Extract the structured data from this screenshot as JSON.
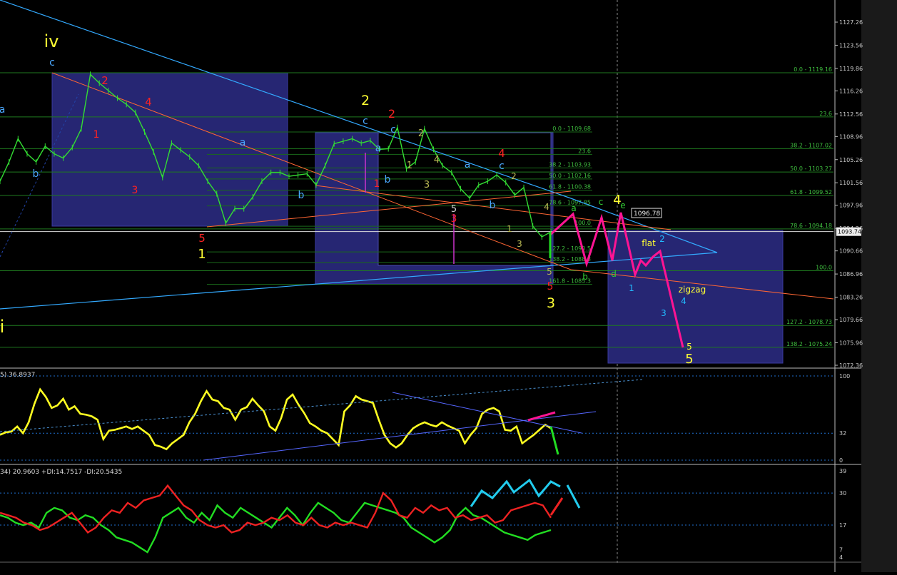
{
  "chart_data": [
    {
      "type": "line",
      "ylim": [
        1072.36,
        1130.96
      ],
      "y_ticks": [
        "1127.26",
        "1123.56",
        "1119.86",
        "1116.26",
        "1112.56",
        "1108.96",
        "1105.26",
        "1101.56",
        "1097.96",
        "1094.26",
        "1090.66",
        "1086.96",
        "1083.26",
        "1079.66",
        "1075.96",
        "1072.36"
      ],
      "price_label": "1093.74",
      "marker_label": "1096.78",
      "price_values": [
        1101.8,
        1104.9,
        1108.6,
        1106.2,
        1104.9,
        1107.4,
        1106.2,
        1105.5,
        1107.2,
        1110.2,
        1118.9,
        1117.5,
        1116.3,
        1115.1,
        1114.1,
        1112.8,
        1109.7,
        1106.5,
        1102.4,
        1107.9,
        1106.8,
        1105.7,
        1104.3,
        1101.8,
        1099.8,
        1095.1,
        1097.4,
        1097.4,
        1099.3,
        1101.8,
        1103.2,
        1103.2,
        1102.6,
        1102.8,
        1103.0,
        1101.2,
        1104.3,
        1107.8,
        1108.2,
        1108.6,
        1107.9,
        1108.3,
        1106.9,
        1107.0,
        1110.4,
        1103.8,
        1104.9,
        1110.2,
        1106.9,
        1104.3,
        1103.2,
        1100.6,
        1099.1,
        1101.2,
        1101.8,
        1102.8,
        1101.6,
        1099.6,
        1100.8,
        1094.6,
        1092.9,
        1093.7
      ],
      "green_labels": [
        {
          "text": "0.0 - 1119.16",
          "price": 1119.16
        },
        {
          "text": "23.6",
          "price": 1112.1
        },
        {
          "text": "38.2 - 1107.02",
          "price": 1107.02
        },
        {
          "text": "50.0 - 1103.27",
          "price": 1103.27
        },
        {
          "text": "61.8 - 1099.52",
          "price": 1099.52
        },
        {
          "text": "78.6 - 1094.18",
          "price": 1094.18
        },
        {
          "text": "100.0",
          "price": 1087.48
        },
        {
          "text": "127.2 - 1078.73",
          "price": 1078.73
        },
        {
          "text": "138.2 - 1075.24",
          "price": 1075.24
        }
      ],
      "inner_fib_labels": [
        {
          "text": "0.0 - 1109.68",
          "price": 1109.68
        },
        {
          "text": "23.6",
          "price": 1106.1
        },
        {
          "text": "38.2 - 1103.93",
          "price": 1103.93
        },
        {
          "text": "50.0 - 1102.16",
          "price": 1102.16
        },
        {
          "text": "61.8 - 1100.38",
          "price": 1100.38
        },
        {
          "text": "78.6 - 1097.85",
          "price": 1097.85
        },
        {
          "text": "100.0",
          "price": 1094.6
        },
        {
          "text": "127.2 - 1090.5",
          "price": 1090.5
        },
        {
          "text": "138.2 - 1088.8",
          "price": 1088.8
        },
        {
          "text": "161.8 - 1085.3",
          "price": 1085.3
        }
      ],
      "wave_labels": [
        {
          "text": "iv",
          "color": "#ffff33",
          "size": 24
        },
        {
          "text": "c",
          "color": "#4aa8ff",
          "size": 14
        },
        {
          "text": "a",
          "color": "#4aa8ff",
          "size": 14
        },
        {
          "text": "b",
          "color": "#4aa8ff",
          "size": 14
        },
        {
          "text": "2",
          "color": "#ff2222",
          "size": 15
        },
        {
          "text": "4",
          "color": "#ff2222",
          "size": 15
        },
        {
          "text": "1",
          "color": "#ff2222",
          "size": 14
        },
        {
          "text": "3",
          "color": "#ff2222",
          "size": 14
        },
        {
          "text": "5",
          "color": "#ff2222",
          "size": 15
        },
        {
          "text": "1",
          "color": "#ffff33",
          "size": 18
        },
        {
          "text": "a",
          "color": "#4aa8ff",
          "size": 14
        },
        {
          "text": "b",
          "color": "#4aa8ff",
          "size": 14
        },
        {
          "text": "2",
          "color": "#ffff33",
          "size": 19
        },
        {
          "text": "c",
          "color": "#4aa8ff",
          "size": 14
        },
        {
          "text": "1",
          "color": "#ff2222",
          "size": 14
        },
        {
          "text": "2",
          "color": "#ff2222",
          "size": 16
        },
        {
          "text": "c",
          "color": "#4aa8ff",
          "size": 14
        },
        {
          "text": "a",
          "color": "#4aa8ff",
          "size": 14
        },
        {
          "text": "b",
          "color": "#4aa8ff",
          "size": 14
        },
        {
          "text": "2",
          "color": "#bbbb55",
          "size": 13
        },
        {
          "text": "1",
          "color": "#bbbb55",
          "size": 13
        },
        {
          "text": "4",
          "color": "#bbbb55",
          "size": 13
        },
        {
          "text": "3",
          "color": "#bbbb55",
          "size": 13
        },
        {
          "text": "5",
          "color": "#cccccc",
          "size": 13
        },
        {
          "text": "3",
          "color": "#ff2222",
          "size": 14
        },
        {
          "text": "a",
          "color": "#4aa8ff",
          "size": 14
        },
        {
          "text": "c",
          "color": "#4aa8ff",
          "size": 14
        },
        {
          "text": "4",
          "color": "#ff2222",
          "size": 15
        },
        {
          "text": "b",
          "color": "#4aa8ff",
          "size": 14
        },
        {
          "text": "2",
          "color": "#bbbb55",
          "size": 12
        },
        {
          "text": "1",
          "color": "#bbbb55",
          "size": 12
        },
        {
          "text": "3",
          "color": "#bbbb55",
          "size": 12
        },
        {
          "text": "4",
          "color": "#bbbb55",
          "size": 12
        },
        {
          "text": "5",
          "color": "#bbbb55",
          "size": 12
        },
        {
          "text": "5",
          "color": "#ff2222",
          "size": 14
        },
        {
          "text": "3",
          "color": "#ffff33",
          "size": 19
        },
        {
          "text": "a",
          "color": "#33cc33",
          "size": 12
        },
        {
          "text": "b",
          "color": "#33cc33",
          "size": 12
        },
        {
          "text": "c",
          "color": "#33cc33",
          "size": 12
        },
        {
          "text": "d",
          "color": "#33cc33",
          "size": 12
        },
        {
          "text": "4",
          "color": "#ffff33",
          "size": 18
        },
        {
          "text": "e",
          "color": "#33cc33",
          "size": 12
        },
        {
          "text": "flat",
          "color": "#ffff33",
          "size": 12
        },
        {
          "text": "2",
          "color": "#22bbff",
          "size": 12
        },
        {
          "text": "1",
          "color": "#22bbff",
          "size": 12
        },
        {
          "text": "3",
          "color": "#22bbff",
          "size": 12
        },
        {
          "text": "zigzag",
          "color": "#ffff33",
          "size": 12
        },
        {
          "text": "4",
          "color": "#22bbff",
          "size": 12
        },
        {
          "text": "5",
          "color": "#ffff33",
          "size": 12
        },
        {
          "text": "5",
          "color": "#ffff33",
          "size": 18
        },
        {
          "text": "i",
          "color": "#ffff33",
          "size": 24
        }
      ]
    },
    {
      "type": "line",
      "title": "5) 36.8937",
      "ylim": [
        0,
        100
      ],
      "y_ticks": [
        "100",
        "32",
        "0"
      ],
      "series": [
        {
          "color": "#ffff22",
          "values": [
            30,
            33,
            34,
            40,
            32,
            45,
            67,
            84,
            75,
            62,
            65,
            73,
            60,
            64,
            55,
            54,
            52,
            48,
            25,
            35,
            36,
            38,
            40,
            37,
            40,
            35,
            30,
            18,
            16,
            13,
            20,
            25,
            30,
            45,
            55,
            70,
            82,
            72,
            70,
            62,
            60,
            48,
            60,
            63,
            73,
            65,
            58,
            40,
            35,
            50,
            72,
            78,
            66,
            56,
            44,
            40,
            35,
            32,
            25,
            18,
            58,
            65,
            76,
            72,
            70,
            68,
            48,
            30,
            20,
            15,
            20,
            30,
            38,
            42,
            45,
            42,
            40,
            45,
            41,
            38,
            35,
            20,
            30,
            38,
            55,
            60,
            62,
            58,
            36,
            35,
            40,
            20,
            25,
            30,
            36,
            42,
            38
          ]
        }
      ]
    },
    {
      "type": "line",
      "title": "34) 20.9603 +DI:14.7517 -DI:20.5435",
      "ylim": [
        4,
        39
      ],
      "y_ticks": [
        "39",
        "30",
        "17",
        "7",
        "4"
      ],
      "series": [
        {
          "color": "#22dd22",
          "values": [
            21,
            20,
            18,
            17,
            18,
            16,
            22,
            24,
            23,
            20,
            19,
            21,
            20,
            17,
            15,
            12,
            11,
            10,
            8,
            6,
            12,
            20,
            22,
            24,
            20,
            18,
            22,
            19,
            25,
            22,
            20,
            24,
            22,
            20,
            18,
            16,
            20,
            24,
            21,
            17,
            22,
            26,
            24,
            22,
            19,
            18,
            22,
            26,
            25,
            24,
            23,
            22,
            20,
            16,
            14,
            12,
            10,
            12,
            15,
            21,
            24,
            21,
            20,
            18,
            16,
            14,
            13,
            12,
            11,
            13,
            14,
            15
          ]
        },
        {
          "color": "#ee2222",
          "values": [
            22,
            21,
            20,
            18,
            17,
            15,
            16,
            18,
            20,
            22,
            18,
            14,
            16,
            20,
            23,
            22,
            26,
            24,
            27,
            28,
            29,
            33,
            29,
            25,
            23,
            19,
            17,
            16,
            17,
            14,
            15,
            18,
            17,
            18,
            20,
            19,
            21,
            18,
            17,
            20,
            17,
            16,
            18,
            17,
            18,
            17,
            16,
            22,
            30,
            27,
            21,
            20,
            24,
            22,
            25,
            23,
            24,
            20,
            21,
            19,
            20,
            21,
            18,
            19,
            23,
            24,
            25,
            26,
            25,
            20
          ]
        }
      ]
    }
  ]
}
